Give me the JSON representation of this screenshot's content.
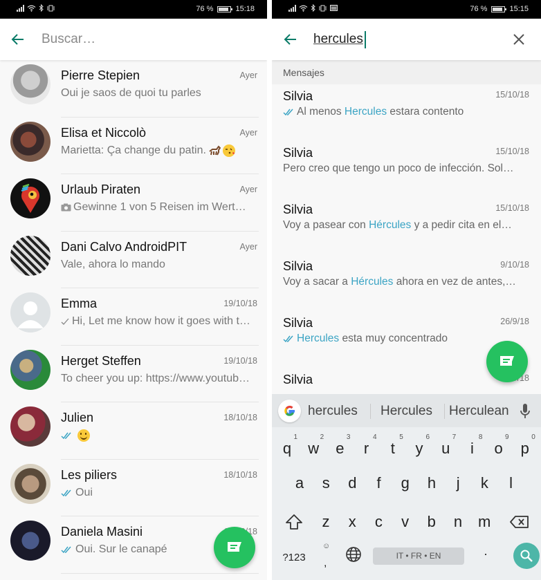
{
  "left_screen": {
    "status_bar": {
      "battery": "76 %",
      "time": "15:18"
    },
    "search": {
      "placeholder": "Buscar…",
      "value": ""
    },
    "chats": [
      {
        "name": "Pierre Stepien",
        "time": "Ayer",
        "preview": "Oui je saos de quoi tu parles",
        "status": "none",
        "avatar": "photo"
      },
      {
        "name": "Elisa et Niccolò",
        "time": "Ayer",
        "preview": "Marietta: Ça change du patin.",
        "status": "none",
        "avatar": "photo",
        "emoji": [
          "horse-icon",
          "kiss-face-icon"
        ]
      },
      {
        "name": "Urlaub Piraten",
        "time": "Ayer",
        "preview": "Gewinne 1 von 5 Reisen im Wert…",
        "status": "photo",
        "avatar": "logo"
      },
      {
        "name": "Dani Calvo AndroidPIT",
        "time": "Ayer",
        "preview": "Vale, ahora lo mando",
        "status": "none",
        "avatar": "photo"
      },
      {
        "name": "Emma",
        "time": "19/10/18",
        "preview": "Hi, Let me know how it goes with t…",
        "status": "sent",
        "avatar": "default"
      },
      {
        "name": "Herget Steffen",
        "time": "19/10/18",
        "preview": "To cheer you up: https://www.youtub…",
        "status": "none",
        "avatar": "photo"
      },
      {
        "name": "Julien",
        "time": "18/10/18",
        "preview": "",
        "status": "read",
        "avatar": "photo",
        "emoji": [
          "smile-icon"
        ]
      },
      {
        "name": "Les piliers",
        "time": "18/10/18",
        "preview": "Oui",
        "status": "read",
        "avatar": "photo"
      },
      {
        "name": "Daniela Masini",
        "time": "18/10/18",
        "preview": "Oui. Sur le canapé",
        "status": "read",
        "avatar": "photo"
      }
    ],
    "fab_icon": "new-chat-icon"
  },
  "right_screen": {
    "status_bar": {
      "battery": "76 %",
      "time": "15:15"
    },
    "search": {
      "value": "hercules"
    },
    "section_header": "Mensajes",
    "messages": [
      {
        "name": "Silvia",
        "time": "15/10/18",
        "status": "read",
        "before": "Al menos ",
        "match": "Hercules",
        "after": " estara contento"
      },
      {
        "name": "Silvia",
        "time": "15/10/18",
        "status": "none",
        "before": "Pero creo que tengo un poco de infección. Sol…",
        "match": "",
        "after": ""
      },
      {
        "name": "Silvia",
        "time": "15/10/18",
        "status": "none",
        "before": "Voy a pasear con ",
        "match": "Hércules",
        "after": " y a pedir cita en el…"
      },
      {
        "name": "Silvia",
        "time": "9/10/18",
        "status": "none",
        "before": "Voy a sacar a ",
        "match": "Hércules",
        "after": " ahora en vez de antes,…"
      },
      {
        "name": "Silvia",
        "time": "26/9/18",
        "status": "read",
        "before": "",
        "match": "Hercules",
        "after": " esta muy concentrado"
      },
      {
        "name": "Silvia",
        "time": "19/9/18",
        "status": "none",
        "before": "",
        "match": "",
        "after": ""
      }
    ],
    "keyboard": {
      "suggestions": [
        "hercules",
        "Hercules",
        "Herculean"
      ],
      "row1": [
        {
          "key": "q",
          "hint": "1"
        },
        {
          "key": "w",
          "hint": "2"
        },
        {
          "key": "e",
          "hint": "3"
        },
        {
          "key": "r",
          "hint": "4"
        },
        {
          "key": "t",
          "hint": "5"
        },
        {
          "key": "y",
          "hint": "6"
        },
        {
          "key": "u",
          "hint": "7"
        },
        {
          "key": "i",
          "hint": "8"
        },
        {
          "key": "o",
          "hint": "9"
        },
        {
          "key": "p",
          "hint": "0"
        }
      ],
      "row2": [
        "a",
        "s",
        "d",
        "f",
        "g",
        "h",
        "j",
        "k",
        "l"
      ],
      "row3": [
        "z",
        "x",
        "c",
        "v",
        "b",
        "n",
        "m"
      ],
      "symbols_label": "?123",
      "comma_label": ",",
      "space_label": "IT • FR • EN",
      "period_label": "."
    },
    "colors": {
      "accent_teal": "#0a7b68",
      "fab_green": "#25c160",
      "highlight_blue": "#3ba4c4",
      "keyboard_action": "#4db6a8"
    }
  }
}
